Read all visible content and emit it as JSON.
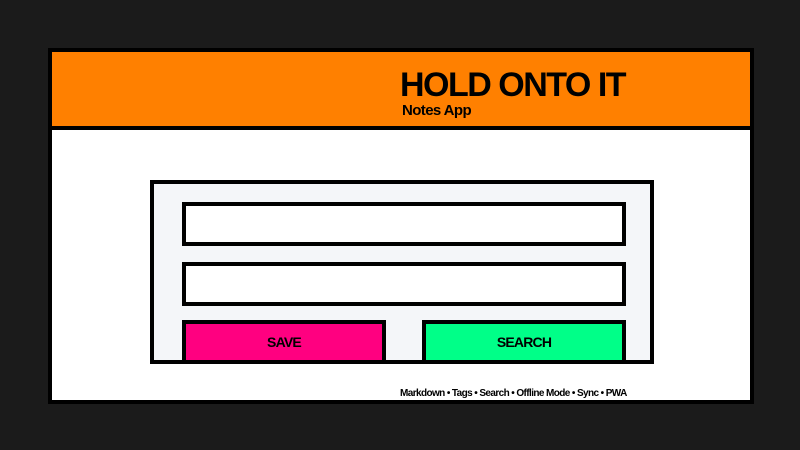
{
  "header": {
    "title": "HOLD ONTO IT",
    "subtitle": "Notes App"
  },
  "form": {
    "field_1": {
      "value": "",
      "placeholder": ""
    },
    "field_2": {
      "value": "",
      "placeholder": ""
    },
    "save_label": "SAVE",
    "search_label": "SEARCH"
  },
  "footer": {
    "features": "Markdown • Tags • Search • Offline Mode • Sync • PWA"
  },
  "colors": {
    "background": "#1b1b1b",
    "header": "#ff8000",
    "save_button": "#ff0080",
    "search_button": "#00ff88",
    "card": "#f4f6f9",
    "border": "#000000"
  }
}
